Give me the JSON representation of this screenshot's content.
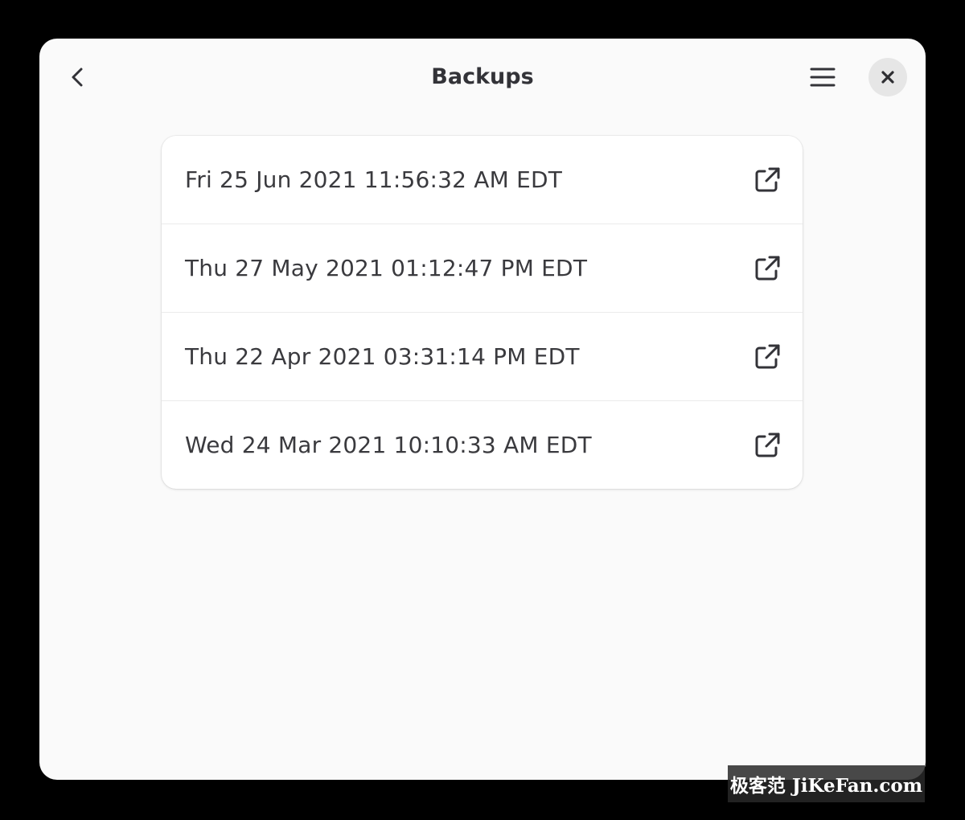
{
  "window": {
    "title": "Backups"
  },
  "header": {
    "back_icon": "chevron-left-icon",
    "menu_icon": "hamburger-menu-icon",
    "close_icon": "close-icon"
  },
  "backups": [
    {
      "label": "Fri 25 Jun 2021 11:56:32 AM EDT",
      "icon": "external-link-icon"
    },
    {
      "label": "Thu 27 May 2021 01:12:47 PM EDT",
      "icon": "external-link-icon"
    },
    {
      "label": "Thu 22 Apr 2021 03:31:14 PM EDT",
      "icon": "external-link-icon"
    },
    {
      "label": "Wed 24 Mar 2021 10:10:33 AM EDT",
      "icon": "external-link-icon"
    }
  ],
  "watermark": {
    "text": "极客范 JiKeFan.com"
  },
  "colors": {
    "background": "#000000",
    "window": "#fafafa",
    "card": "#ffffff",
    "text": "#3a3a3e",
    "close_button_bg": "#e6e6e6"
  }
}
